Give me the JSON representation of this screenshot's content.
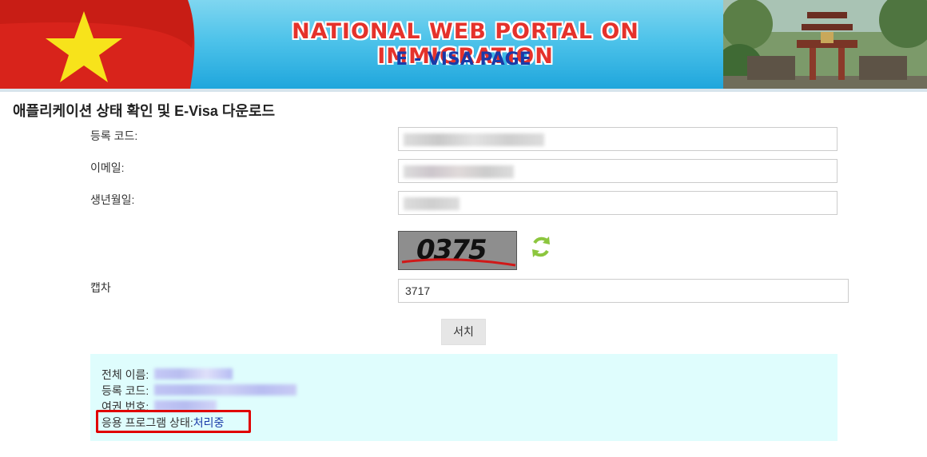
{
  "banner": {
    "title": "NATIONAL WEB PORTAL ON IMMIGRATION",
    "subtitle": "E - VISA PAGE"
  },
  "page_title": "애플리케이션 상태 확인 및 E-Visa 다운로드",
  "form": {
    "registration_code_label": "등록 코드:",
    "email_label": "이메일:",
    "dob_label": "생년월일:",
    "captcha_label": "캡차",
    "captcha_value": "3717",
    "captcha_image_text": "0375",
    "search_button": "서치"
  },
  "result": {
    "full_name_label": "전체 이름:",
    "registration_code_label": "등록 코드:",
    "passport_label": "여권 번호:",
    "status_label": "응용 프로그램 상태:",
    "status_value": "처리중"
  },
  "colors": {
    "banner_title": "#e5322b",
    "banner_subtitle": "#1a3aa8",
    "result_bg": "#dffdfd",
    "status_highlight": "#e00000",
    "status_value": "#1a3aa8"
  }
}
